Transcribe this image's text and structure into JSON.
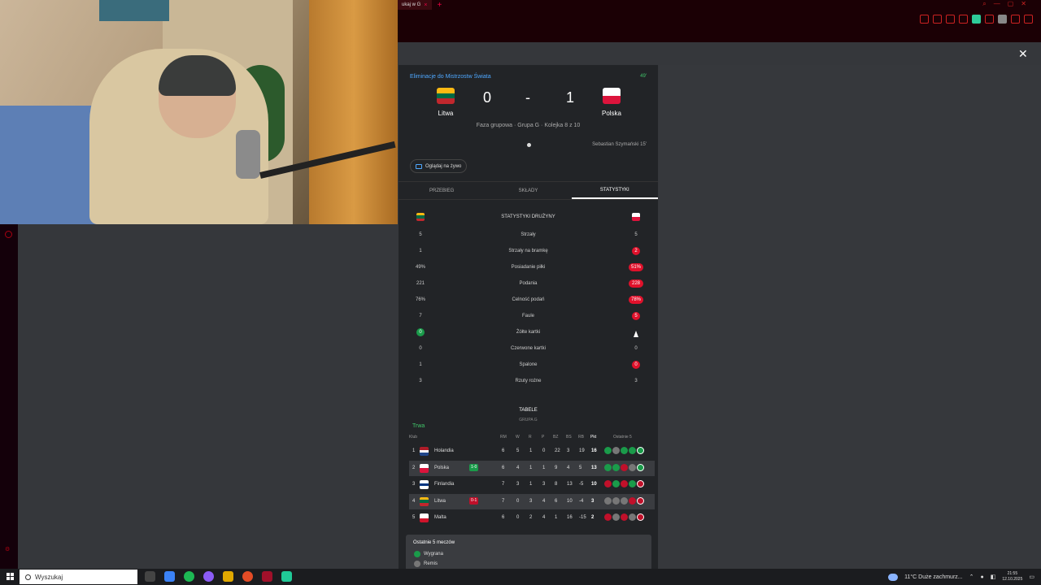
{
  "browser": {
    "tab_title": "ukaj w G",
    "tab_close": "×",
    "new_tab": "+",
    "page_close": "✕"
  },
  "match": {
    "competition": "Eliminacje do Mistrzostw Świata",
    "minute": "49'",
    "home": {
      "name": "Litwa",
      "score": "0",
      "flag_colors": [
        "#fdb913",
        "#006a44",
        "#c1272d"
      ]
    },
    "away": {
      "name": "Polska",
      "score": "1",
      "flag_colors": [
        "#ffffff",
        "#dc143c"
      ]
    },
    "separator": "-",
    "phase": "Faza grupowa · Grupa G · Kolejka 8 z 10",
    "scorer": "Sebastian Szymański 15'",
    "watch_label": "Oglądaj na żywo"
  },
  "tabs": [
    {
      "label": "PRZEBIEG",
      "active": false
    },
    {
      "label": "SKŁADY",
      "active": false
    },
    {
      "label": "STATYSTYKI",
      "active": true
    }
  ],
  "stats": {
    "title": "STATYSTYKI DRUŻYNY",
    "rows": [
      {
        "name": "Strzały",
        "home": "5",
        "away": "5",
        "lead": "none"
      },
      {
        "name": "Strzały na bramkę",
        "home": "1",
        "away": "2",
        "lead": "away"
      },
      {
        "name": "Posiadanie piłki",
        "home": "49%",
        "away": "51%",
        "lead": "away"
      },
      {
        "name": "Podania",
        "home": "221",
        "away": "228",
        "lead": "away"
      },
      {
        "name": "Celność podań",
        "home": "76%",
        "away": "78%",
        "lead": "away"
      },
      {
        "name": "Faule",
        "home": "7",
        "away": "5",
        "lead": "away"
      },
      {
        "name": "Żółte kartki",
        "home": "0",
        "away": "",
        "lead": "home"
      },
      {
        "name": "Czerwone kartki",
        "home": "0",
        "away": "0",
        "lead": "none"
      },
      {
        "name": "Spalone",
        "home": "1",
        "away": "0",
        "lead": "away"
      },
      {
        "name": "Rzuty rożne",
        "home": "3",
        "away": "3",
        "lead": "none"
      }
    ]
  },
  "tables": {
    "title": "TABELE",
    "subtitle": "GRUPA G",
    "live_label": "Trwa",
    "headers": {
      "club": "Klub",
      "rm": "RM",
      "w": "W",
      "r": "R",
      "p": "P",
      "bz": "BZ",
      "bs": "BS",
      "rb": "RB",
      "pkt": "Pkt",
      "last5": "Ostatnie 5"
    },
    "rows": [
      {
        "pos": "1",
        "team": "Holandia",
        "flag": [
          "#ae1c28",
          "#ffffff",
          "#21468b"
        ],
        "badge": "",
        "rm": "6",
        "w": "5",
        "r": "1",
        "p": "0",
        "bz": "22",
        "bs": "3",
        "rb": "19",
        "pkt": "16",
        "form": [
          "W",
          "D",
          "W",
          "W",
          "W"
        ]
      },
      {
        "pos": "2",
        "team": "Polska",
        "flag": [
          "#ffffff",
          "#dc143c"
        ],
        "badge": "1-0",
        "badge_type": "g",
        "rm": "6",
        "w": "4",
        "r": "1",
        "p": "1",
        "bz": "9",
        "bs": "4",
        "rb": "5",
        "pkt": "13",
        "form": [
          "W",
          "W",
          "L",
          "D",
          "W"
        ]
      },
      {
        "pos": "3",
        "team": "Finlandia",
        "flag": [
          "#ffffff",
          "#003580",
          "#ffffff"
        ],
        "badge": "",
        "rm": "7",
        "w": "3",
        "r": "1",
        "p": "3",
        "bz": "8",
        "bs": "13",
        "rb": "-5",
        "pkt": "10",
        "form": [
          "L",
          "W",
          "L",
          "W",
          "L"
        ]
      },
      {
        "pos": "4",
        "team": "Litwa",
        "flag": [
          "#fdb913",
          "#006a44",
          "#c1272d"
        ],
        "badge": "0-1",
        "badge_type": "r",
        "rm": "7",
        "w": "0",
        "r": "3",
        "p": "4",
        "bz": "6",
        "bs": "10",
        "rb": "-4",
        "pkt": "3",
        "form": [
          "D",
          "D",
          "D",
          "L",
          "L"
        ]
      },
      {
        "pos": "5",
        "team": "Malta",
        "flag": [
          "#ffffff",
          "#cf142b"
        ],
        "badge": "",
        "rm": "6",
        "w": "0",
        "r": "2",
        "p": "4",
        "bz": "1",
        "bs": "16",
        "rb": "-15",
        "pkt": "2",
        "form": [
          "L",
          "D",
          "L",
          "D",
          "L"
        ]
      }
    ]
  },
  "legend": {
    "title": "Ostatnie 5 meczów",
    "items": [
      {
        "label": "Wygrana",
        "color": "#1a9b4a"
      },
      {
        "label": "Remis",
        "color": "#777777"
      }
    ]
  },
  "taskbar": {
    "search_placeholder": "Wyszukaj",
    "weather": "11°C  Duże zachmurz...",
    "time": "21:55",
    "date": "12.10.2025"
  }
}
